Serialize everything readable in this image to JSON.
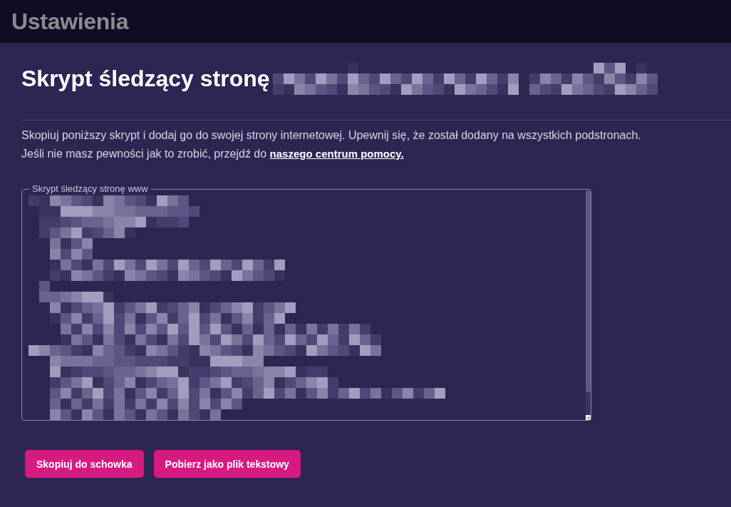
{
  "header": {
    "title": "Ustawienia"
  },
  "page": {
    "heading": "Skrypt śledzący stronę",
    "heading_redacted": true
  },
  "intro": {
    "line_1": "Skopiuj poniższy skrypt i dodaj go do swojej strony internetowej. Upewnij się, że został dodany na wszystkich podstronach.",
    "line_2": "Jeśli nie masz pewności jak to zrobić, przejdź do",
    "link": "naszego centrum pomocy."
  },
  "script_field": {
    "label": "Skrypt śledzący stronę www",
    "content_redacted": true
  },
  "buttons": [
    "Skopiuj do schowka",
    "Pobierz jako plik tekstowy"
  ]
}
